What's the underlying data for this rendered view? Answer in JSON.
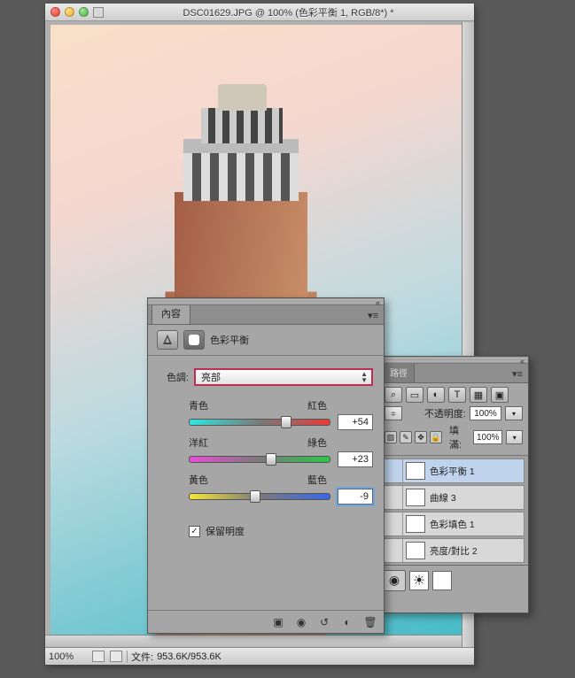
{
  "doc": {
    "title": "DSC01629.JPG @ 100% (色彩平衡 1, RGB/8*) *",
    "zoom": "100%",
    "status_prefix": "文件:",
    "status": "953.6K/953.6K"
  },
  "props_panel": {
    "tab": "內容",
    "title": "色彩平衡",
    "tone_label": "色調:",
    "tone_value": "亮部",
    "sliders": [
      {
        "left": "青色",
        "right": "紅色",
        "value": "+54",
        "pos": 69
      },
      {
        "left": "洋紅",
        "right": "綠色",
        "value": "+23",
        "pos": 58
      },
      {
        "left": "黃色",
        "right": "藍色",
        "value": "-9",
        "pos": 47,
        "active": true
      }
    ],
    "preserve_lum": "保留明度"
  },
  "layers_panel": {
    "tabs": [
      "路徑"
    ],
    "filter_letters": [
      "⌕",
      "▭",
      "◐",
      "T",
      "▦",
      "▣"
    ],
    "opacity_label": "不透明度:",
    "opacity_value": "100%",
    "fill_label": "填滿:",
    "fill_value": "100%",
    "lock_label": "鎖:",
    "layers": [
      {
        "name": "色彩平衡 1",
        "selected": true
      },
      {
        "name": "曲線 3"
      },
      {
        "name": "色彩填色 1"
      },
      {
        "name": "亮度/對比 2"
      }
    ]
  }
}
